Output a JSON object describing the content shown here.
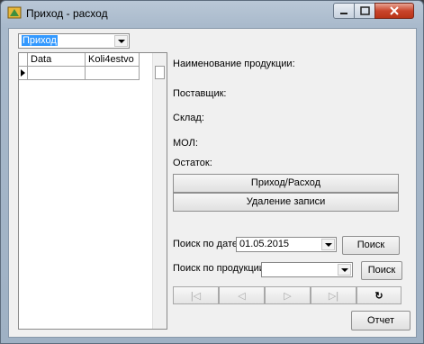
{
  "window": {
    "title": "Приход - расход",
    "icon": "app-icon"
  },
  "type_combo": {
    "value": "Приход"
  },
  "grid": {
    "columns": [
      "Data",
      "Koli4estvo"
    ],
    "rows": [
      [
        "",
        ""
      ]
    ]
  },
  "labels": {
    "product_name": "Наименование продукции:",
    "supplier": "Поставщик:",
    "warehouse": "Склад:",
    "mol": "МОЛ:",
    "remainder": "Остаток:"
  },
  "buttons": {
    "income_expense": "Приход/Расход",
    "delete_record": "Удаление записи",
    "search_date": "Поиск",
    "search_product": "Поиск",
    "report": "Отчет"
  },
  "search": {
    "by_date_label": "Поиск по дате",
    "date_value": "01.05.2015",
    "by_product_label": "Поиск по продукции:",
    "product_value": ""
  },
  "navigator": {
    "icons": [
      "first-icon",
      "prev-icon",
      "next-icon",
      "last-icon",
      "refresh-icon"
    ]
  }
}
